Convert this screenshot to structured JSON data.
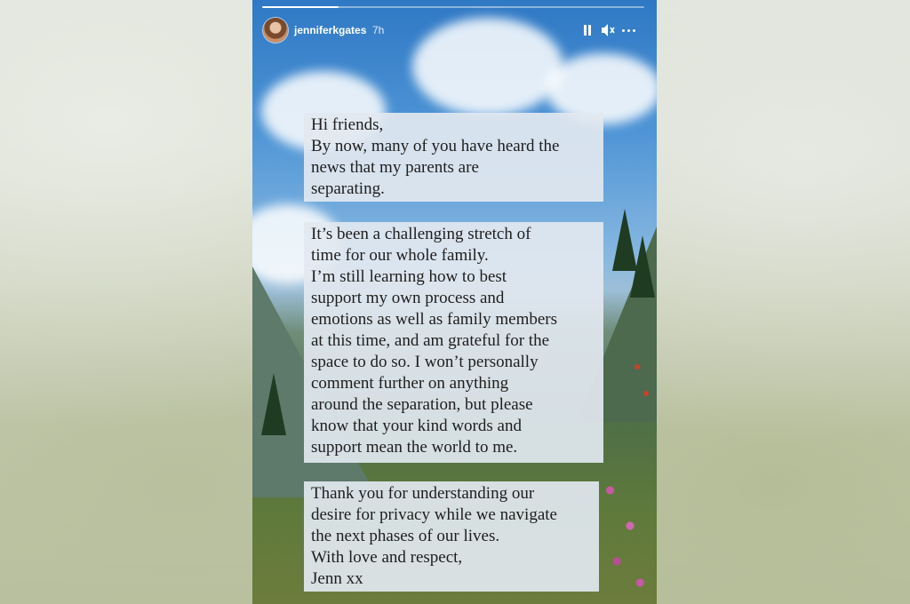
{
  "story": {
    "username": "jenniferkgates",
    "time_ago": "7h",
    "progress": 0.2,
    "icons": {
      "pause": "pause-icon",
      "mute": "speaker-muted-icon",
      "more": "more-options-icon"
    }
  },
  "text_blocks": [
    "Hi friends,\nBy now, many of you have heard the\nnews that my parents are\nseparating.",
    "It’s been a challenging stretch of\ntime for our whole family.\nI’m still learning how to best\nsupport my own process and\nemotions as well as family members\nat this time, and am grateful for the\nspace to do so. I won’t personally\ncomment further on anything\naround the separation, but please\nknow that your kind words and\nsupport mean the world to me.",
    "Thank you for understanding our\ndesire for privacy while we navigate\nthe next phases of our lives.\nWith love and respect,\nJenn xx"
  ]
}
